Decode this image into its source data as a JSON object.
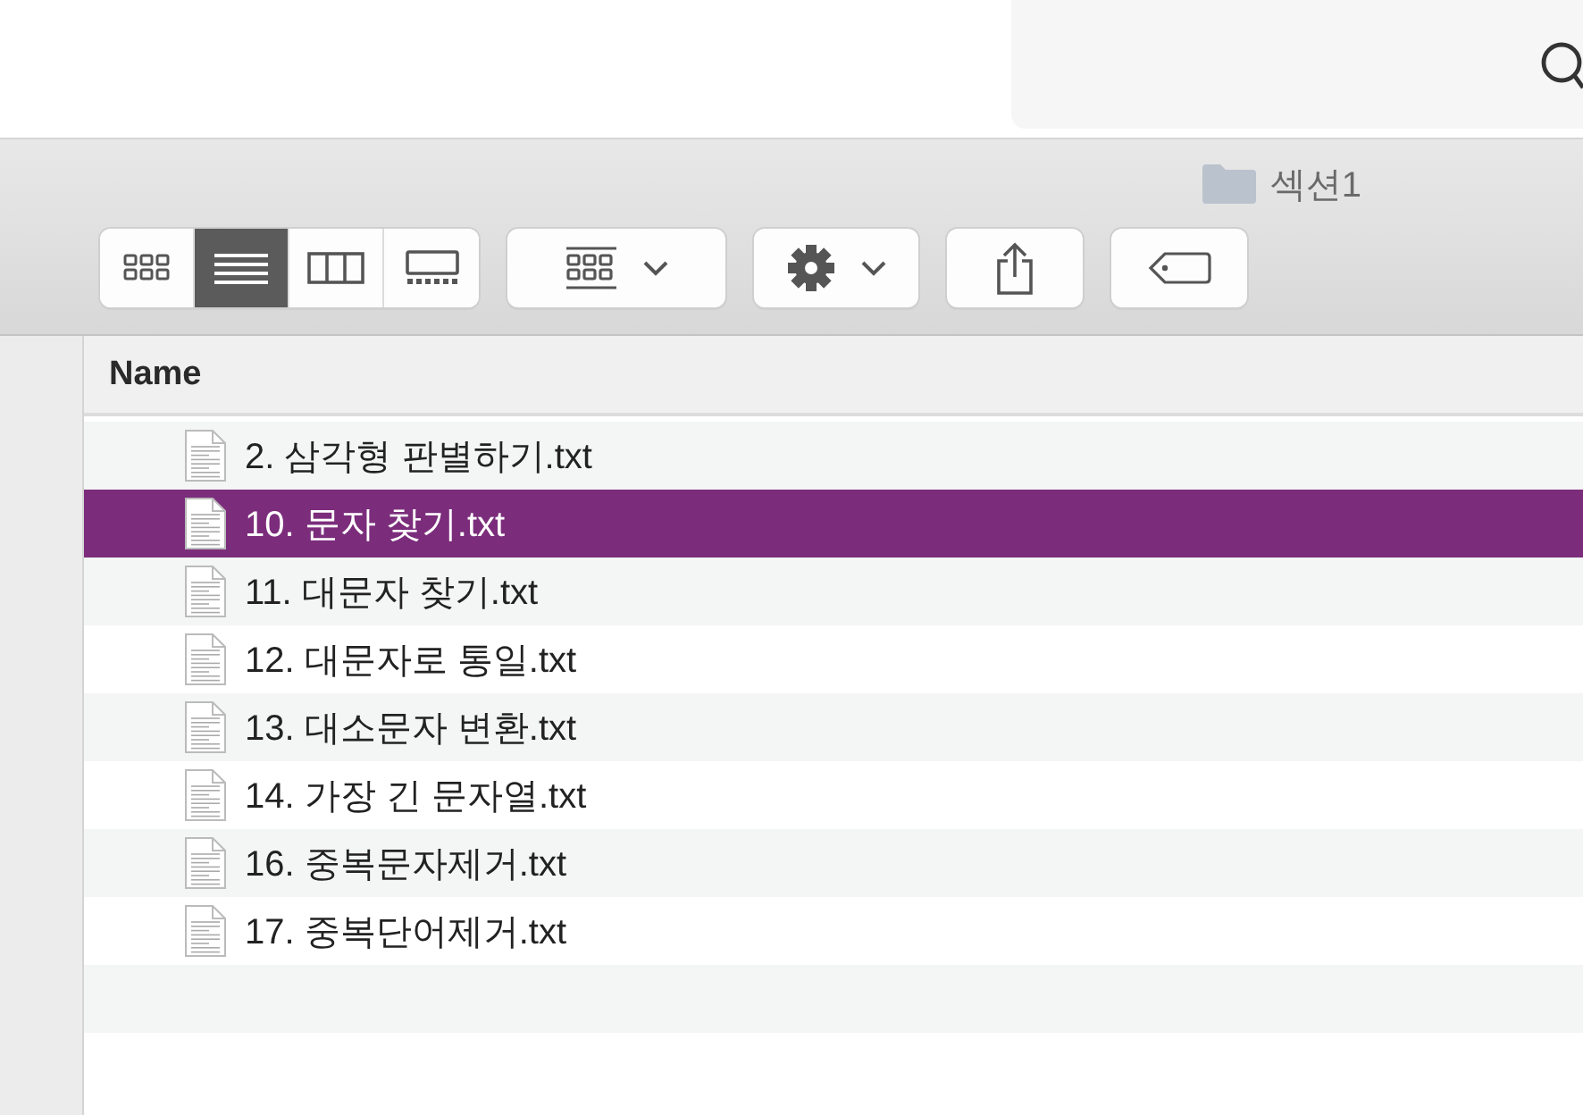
{
  "window": {
    "title": "섹션1"
  },
  "view_modes": [
    {
      "kind": "icons",
      "selected": false
    },
    {
      "kind": "list",
      "selected": true
    },
    {
      "kind": "columns",
      "selected": false
    },
    {
      "kind": "gallery",
      "selected": false
    }
  ],
  "table": {
    "columns": [
      "Name"
    ],
    "rows": [
      {
        "name": "2. 삼각형 판별하기.txt",
        "selected": false
      },
      {
        "name": "10. 문자 찾기.txt",
        "selected": true
      },
      {
        "name": "11. 대문자 찾기.txt",
        "selected": false
      },
      {
        "name": "12. 대문자로 통일.txt",
        "selected": false
      },
      {
        "name": "13. 대소문자 변환.txt",
        "selected": false
      },
      {
        "name": "14. 가장 긴 문자열.txt",
        "selected": false
      },
      {
        "name": "16. 중복문자제거.txt",
        "selected": false
      },
      {
        "name": "17. 중복단어제거.txt",
        "selected": false
      }
    ]
  }
}
